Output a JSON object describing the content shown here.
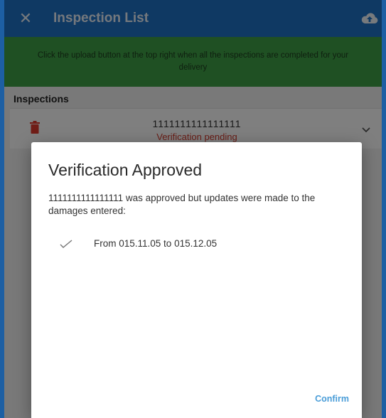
{
  "app_bar": {
    "title": "Inspection List",
    "close_icon": "close-icon",
    "upload_icon": "cloud-upload-icon",
    "color": "#1e73c6"
  },
  "banner": {
    "text": "Click the upload button at the top right when all the inspections are completed for your delivery",
    "color": "#3fa046"
  },
  "inspections": {
    "header": "Inspections",
    "items": [
      {
        "id": "1111111111111111",
        "status": "Verification pending",
        "status_color": "#d33a2c",
        "delete_icon": "trash-icon",
        "expand_icon": "chevron-down-icon"
      }
    ]
  },
  "dialog": {
    "title": "Verification Approved",
    "message": "1111111111111111 was approved but updates were made to the damages entered:",
    "changes": [
      {
        "icon": "check-icon",
        "text": "From 015.11.05 to 015.12.05"
      }
    ],
    "confirm_label": "Confirm",
    "confirm_color": "#4a9dd8"
  }
}
